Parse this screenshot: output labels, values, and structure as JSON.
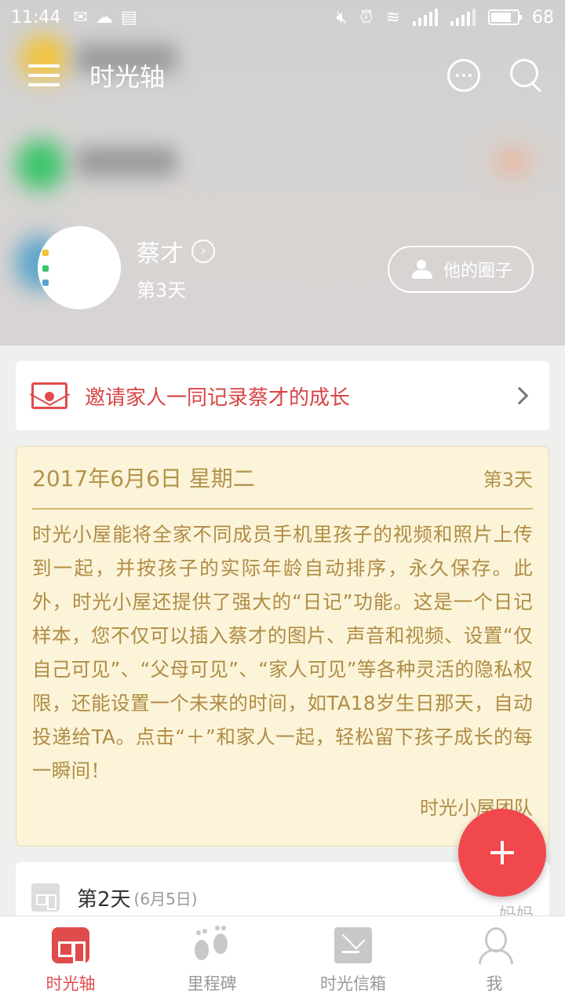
{
  "status_bar": {
    "time": "11:44",
    "battery": "68",
    "network": "4G"
  },
  "header": {
    "title": "时光轴"
  },
  "profile": {
    "name": "蔡才",
    "day": "第3天",
    "circle_button": "他的圈子"
  },
  "invite": {
    "text": "邀请家人一同记录蔡才的成长"
  },
  "diary": {
    "date": "2017年6月6日 星期二",
    "day": "第3天",
    "body": "时光小屋能将全家不同成员手机里孩子的视频和照片上传到一起，并按孩子的实际年龄自动排序，永久保存。此外，时光小屋还提供了强大的“日记”功能。这是一个日记样本，您不仅可以插入蔡才的图片、声音和视频、设置“仅自己可见”、“父母可见”、“家人可见”等各种灵活的隐私权限，还能设置一个未来的时间，如TA18岁生日那天，自动投递给TA。点击“＋”和家人一起，轻松留下孩子成长的每一瞬间！",
    "signature": "时光小屋团队"
  },
  "entry": {
    "day": "第2天",
    "date": "(6月5日)",
    "author": "妈妈"
  },
  "bottom_nav": [
    {
      "label": "时光轴",
      "icon": "house-icon",
      "active": true
    },
    {
      "label": "里程碑",
      "icon": "footprints-icon",
      "active": false
    },
    {
      "label": "时光信箱",
      "icon": "mail-icon",
      "active": false
    },
    {
      "label": "我",
      "icon": "person-icon",
      "active": false
    }
  ],
  "colors": {
    "accent": "#e04b4b",
    "diary_bg": "#fbf4d9",
    "diary_text": "#b08c44"
  }
}
